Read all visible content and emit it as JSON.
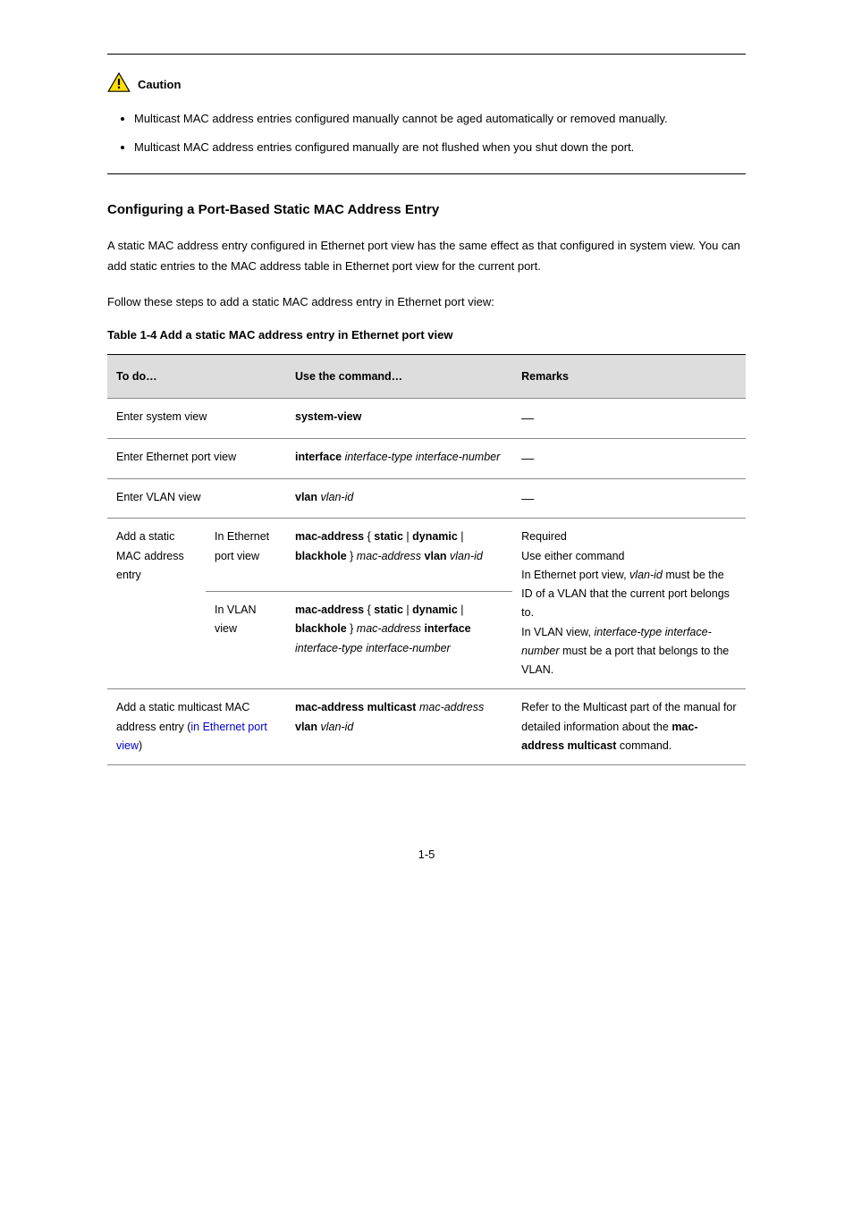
{
  "caution": {
    "label": "Caution",
    "items": [
      "Multicast MAC address entries configured manually cannot be aged automatically or removed manually.",
      "Multicast MAC address entries configured manually are not flushed when you shut down the port."
    ]
  },
  "section": {
    "title": "Configuring a Port-Based Static MAC Address Entry",
    "para1": "A static MAC address entry configured in Ethernet port view has the same effect as that configured in system view. You can add static entries to the MAC address table in Ethernet port view for the current port.",
    "para2": "Follow these steps to add a static MAC address entry in Ethernet port view:",
    "tableCaption": "Table 1-4 Add a static MAC address entry in Ethernet port view",
    "headers": [
      "To do…",
      "Use the command…",
      "Remarks"
    ],
    "rows": {
      "r1": {
        "c1": "Enter system view",
        "c2_bold": "system-view",
        "c3": "—"
      },
      "r2": {
        "c1": "Enter Ethernet port view",
        "c2_bold": "interface",
        "c2_ital": " interface-type interface-number",
        "c3": "—"
      },
      "r3": {
        "c1": "Enter VLAN view",
        "c2_pre": "vlan",
        "c2_ital": " vlan-id",
        "c3": "—"
      },
      "r4a": {
        "c1_group": "Add a static MAC address entry",
        "c1_sub": "In Ethernet port view",
        "c2": "mac-address",
        "c2_after": " { ",
        "c2_b2": "static",
        "c2_after2": " | ",
        "c2_b3": "dynamic",
        "c2_after3": " | ",
        "c2_b4": "blackhole",
        "c2_after4": " } ",
        "c2_ital": "mac-address",
        "c2_b5": " vlan",
        "c2_ital2": " vlan-id",
        "c3_line1": "Required",
        "c3_line2": "Use either command",
        "c3_line3_pre": "In Ethernet port view, ",
        "c3_line3_ital": "vlan-id",
        "c3_line3_post": " must be the ID of a VLAN that the current port belongs to.",
        "c3_line4_pre": "In VLAN view, ",
        "c3_line4_ital": "interface-type interface-number",
        "c3_line4_post": " must be a port that belongs to the VLAN."
      },
      "r4b": {
        "c1_sub": "In VLAN view",
        "c2": "mac-address",
        "c2_after": " { ",
        "c2_b2": "static",
        "c2_after2": " | ",
        "c2_b3": "dynamic",
        "c2_after3": " | ",
        "c2_b4": "blackhole",
        "c2_after4": " } ",
        "c2_ital": "mac-address",
        "c2_b5": " interface",
        "c2_ital2": " interface-type interface-number"
      },
      "r5": {
        "c1_pre": "Add a static multicast MAC address entry (",
        "c1_link": "in Ethernet port view",
        "c1_post": ")",
        "c2_b1": "mac-address multicast",
        "c2_ital1": " mac-address",
        "c2_b2": " vlan",
        "c2_ital2": " vlan-id",
        "c3_pre": "Refer to the Multicast part of the manual for detailed information about the ",
        "c3_b": "mac-address multicast",
        "c3_post": " command."
      }
    }
  },
  "pageNumber": "1-5"
}
